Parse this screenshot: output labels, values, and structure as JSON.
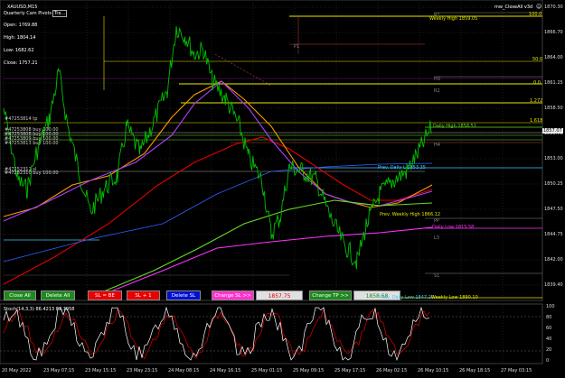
{
  "window": {
    "symbol_label": "XAUUSD,M15",
    "indicator_label": "Quarterly Cam Pivots",
    "tab_label": "Tra…"
  },
  "ea_label": "mw_CloseAll v3d",
  "ohlc": {
    "open": "Open: 1769.88",
    "high": "High: 1804.14",
    "low": "Low: 1682.62",
    "close": "Close: 1757.21"
  },
  "buttons": {
    "close_all": "Close All",
    "delete_all": "Delete All",
    "sl_be": "SL = BE",
    "sl_plus1": "SL + 1",
    "delete_sl": "Delete SL",
    "change_sl": "Change SL >>",
    "change_tp": "Change TP >>"
  },
  "inputs": {
    "sl_value": "1857.75",
    "tp_value": "1858.68"
  },
  "price_axis": [
    "1870.30",
    "1866.70",
    "1864.00",
    "1861.25",
    "1858.50",
    "1855.75",
    "1853.00",
    "1850.25",
    "1847.50",
    "1844.75",
    "1842.00",
    "1839.40"
  ],
  "price_axis_min": 1839.4,
  "price_axis_max": 1870.3,
  "current_price": "1857.07",
  "osc_axis": [
    "100",
    "80",
    "60",
    "40",
    "20",
    "0"
  ],
  "osc_label": "Stoch(14,3,3) 86.4213 82.1958",
  "time_axis": [
    "20 May 2022",
    "23 May 07:15",
    "23 May 15:15",
    "23 May 23:15",
    "24 May 08:15",
    "24 May 16:15",
    "25 May 01:15",
    "25 May 09:15",
    "25 May 17:15",
    "26 May 02:15",
    "26 May 10:15",
    "26 May 18:15",
    "27 May 03:15"
  ],
  "fib_labels": [
    "100.0",
    "50.0",
    "0.0",
    "1.272",
    "1.618"
  ],
  "level_labels": {
    "weekly_high": "Weekly High 1859.05",
    "daily_high": "Daily High 1858.51",
    "prev_daily": "Prev. Daily L 1853.35",
    "prev_weekly_high": "Prev. Weekly High 1866.12",
    "daily_low": "Daily Low 1815.58",
    "prev_daily_low": "Prev. Daily Low 1847.20",
    "weekly_low": "Weekly Low 1890.10",
    "r1": "R1",
    "r2": "R2",
    "h3": "H3",
    "h4": "H4",
    "pp": "PP",
    "s1": "S1",
    "l3": "L3",
    "pl": "P1"
  },
  "order_labels": [
    "#47253814 tp",
    "#47253808 buy 100.00",
    "#47253808 buy 100.00",
    "#47253809 buy 100.00",
    "#47253813 buy 100.00",
    "#47252310 buy 100.00",
    "#47252311 sl",
    "#47251130 sl"
  ],
  "colors": {
    "bg": "#000000",
    "candle": "#00c000",
    "ma_red": "#e00000",
    "ma_orange": "#ff9800",
    "ma_purple": "#b040ff",
    "ma_blue": "#3060ff",
    "ma_lime": "#66dd22",
    "ma_magenta": "#ff33ff",
    "yellow": "#e6e600",
    "btn_red": "#e60000",
    "btn_blue": "#0010d0",
    "btn_green": "#1e8a1e",
    "btn_pink": "#ff33cc"
  }
}
